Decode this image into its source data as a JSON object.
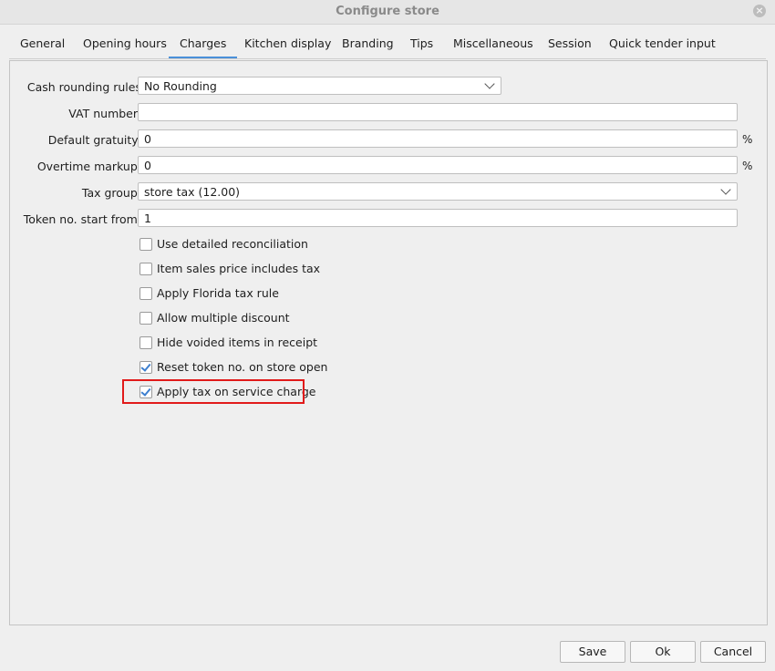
{
  "window": {
    "title": "Configure store"
  },
  "tabs": [
    {
      "label": "General"
    },
    {
      "label": "Opening hours"
    },
    {
      "label": "Charges"
    },
    {
      "label": "Kitchen display"
    },
    {
      "label": "Branding"
    },
    {
      "label": "Tips"
    },
    {
      "label": "Miscellaneous"
    },
    {
      "label": "Session"
    },
    {
      "label": "Quick tender input"
    }
  ],
  "active_tab": "Charges",
  "form": {
    "cash_rounding": {
      "label": "Cash rounding rules",
      "value": "No Rounding"
    },
    "vat_number": {
      "label": "VAT number:",
      "value": ""
    },
    "default_gratuity": {
      "label": "Default gratuity:",
      "value": "0",
      "unit": "%"
    },
    "overtime_markup": {
      "label": "Overtime markup:",
      "value": "0",
      "unit": "%"
    },
    "tax_group": {
      "label": "Tax group:",
      "value": "store tax (12.00)"
    },
    "token_start": {
      "label": "Token no. start from:",
      "value": "1"
    }
  },
  "checkboxes": [
    {
      "label": "Use detailed reconciliation",
      "checked": false
    },
    {
      "label": "Item sales price includes tax",
      "checked": false
    },
    {
      "label": "Apply Florida tax rule",
      "checked": false
    },
    {
      "label": "Allow multiple discount",
      "checked": false
    },
    {
      "label": "Hide voided items in receipt",
      "checked": false
    },
    {
      "label": "Reset token no. on store open",
      "checked": true
    },
    {
      "label": "Apply tax on service charge",
      "checked": true
    }
  ],
  "buttons": {
    "save": "Save",
    "ok": "Ok",
    "cancel": "Cancel"
  },
  "colors": {
    "highlight": "#e11a1a",
    "accent": "#4a90d9"
  }
}
